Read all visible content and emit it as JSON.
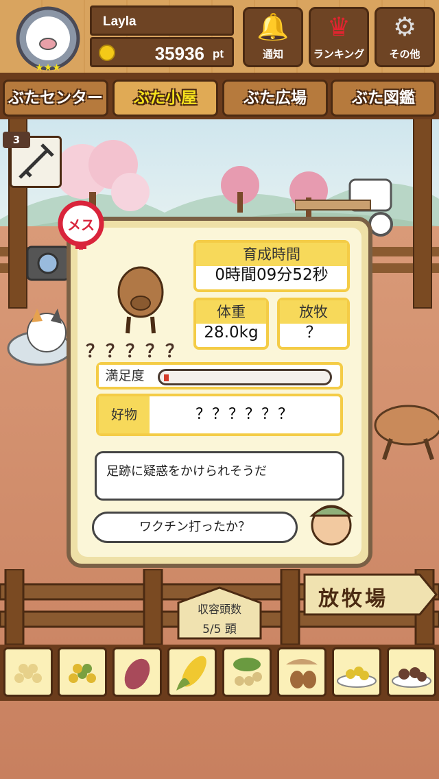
{
  "user": {
    "name": "Layla",
    "points": "35936",
    "points_unit": "pt"
  },
  "header_buttons": [
    {
      "label": "通知",
      "icon": "bell-icon"
    },
    {
      "label": "ランキング",
      "icon": "crown-icon"
    },
    {
      "label": "その他",
      "icon": "gear-icon"
    }
  ],
  "tabs": [
    {
      "label": "ぶたセンター"
    },
    {
      "label": "ぶた小屋"
    },
    {
      "label": "ぶた広場"
    },
    {
      "label": "ぶた図鑑"
    }
  ],
  "active_tab": "ぶた小屋",
  "syringe_count": "3",
  "gender_badge": "メス",
  "pig": {
    "name": "？？？？？",
    "raise_time_label": "育成時間",
    "raise_time": "0時間09分52秒",
    "weight_label": "体重",
    "weight": "28.0kg",
    "grazing_label": "放牧",
    "grazing": "？",
    "satisfaction_label": "満足度",
    "satisfaction_percent": 3,
    "favorite_label": "好物",
    "favorite": "？？？？？？"
  },
  "dialog": {
    "line1": "足跡に疑惑をかけられそうだ",
    "line2": "ワクチン打ったか？"
  },
  "capacity": {
    "label": "収容頭数",
    "value": "5/5 頭"
  },
  "pasture_sign": "放牧場",
  "foods": [
    "soybeans-icon",
    "corn-kernels-icon",
    "sweet-potato-icon",
    "corn-icon",
    "peas-icon",
    "acorn-icon",
    "corn-plate-icon",
    "meatball-plate-icon"
  ],
  "colors": {
    "accent_yellow": "#f7d95a",
    "wood_dark": "#6b3c1c",
    "female_red": "#d9243b"
  }
}
